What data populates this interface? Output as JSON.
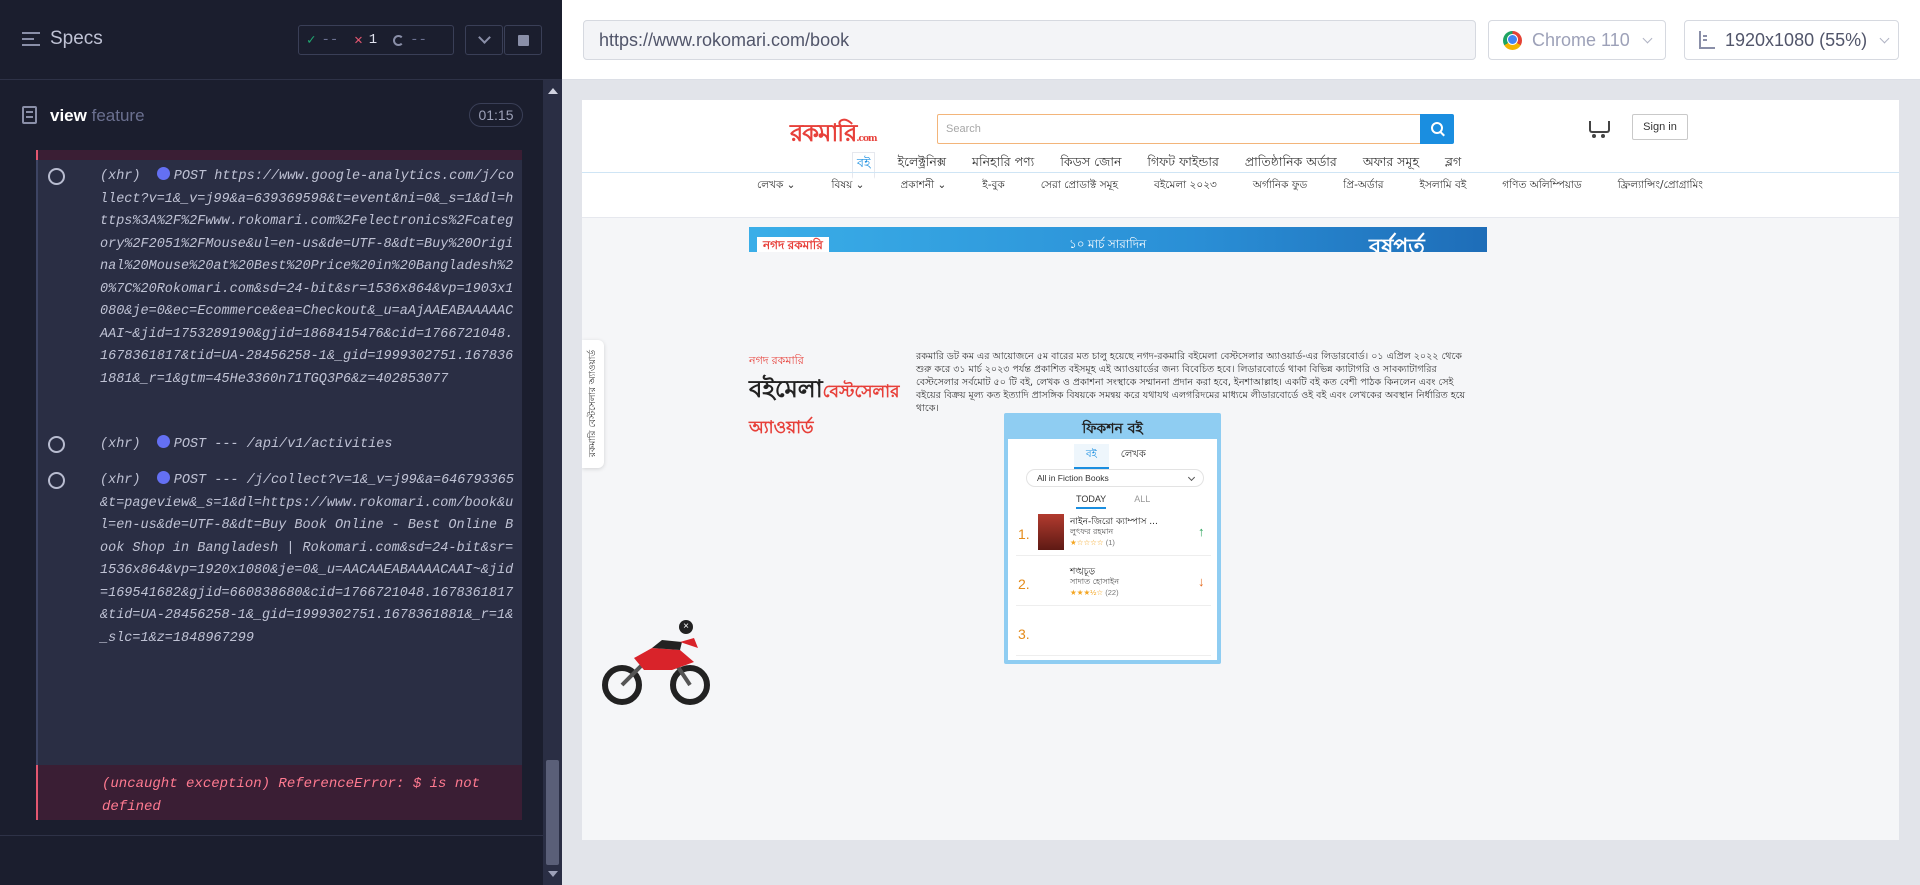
{
  "runner": {
    "specs_title": "Specs",
    "stats": {
      "passed": "--",
      "failed": "1",
      "pending": "--"
    },
    "spec": {
      "name_bold": "view",
      "name_light": "feature",
      "time": "01:15"
    },
    "commands": [
      {
        "type": "(xhr)",
        "method": "POST",
        "url": "https://www.google-analytics.com/j/collect?v=1&_v=j99&a=639369598&t=event&ni=0&_s=1&dl=https%3A%2F%2Fwww.rokomari.com%2Felectronics%2Fcategory%2F2051%2FMouse&ul=en-us&de=UTF-8&dt=Buy%20Original%20Mouse%20at%20Best%20Price%20in%20Bangladesh%20%7C%20Rokomari.com&sd=24-bit&sr=1536x864&vp=1903x1080&je=0&ec=Ecommerce&ea=Checkout&_u=aAjAAEABAAAAACAAI~&jid=1753289190&gjid=1868415476&cid=1766721048.1678361817&tid=UA-28456258-1&_gid=1999302751.1678361881&_r=1&gtm=45He3360n71TGQ3P6&z=402853077"
      },
      {
        "type": "(xhr)",
        "method": "POST",
        "url": "--- /api/v1/activities"
      },
      {
        "type": "(xhr)",
        "method": "POST",
        "url": "--- /j/collect?v=1&_v=j99&a=646793365&t=pageview&_s=1&dl=https://www.rokomari.com/book&ul=en-us&de=UTF-8&dt=Buy Book Online - Best Online Book Shop in Bangladesh | Rokomari.com&sd=24-bit&sr=1536x864&vp=1920x1080&je=0&_u=AACAAEABAAAACAAI~&jid=169541682&gjid=660838680&cid=1766721048.1678361817&tid=UA-28456258-1&_gid=1999302751.1678361881&_r=1&_slc=1&z=1848967299"
      }
    ],
    "error": "(uncaught exception)  ReferenceError: $ is not defined"
  },
  "aut": {
    "url": "https://www.rokomari.com/book",
    "browser": "Chrome 110",
    "viewport": "1920x1080  (55%)"
  },
  "site": {
    "logo_main": "রকমারি",
    "logo_suffix": ".com",
    "search_placeholder": "Search",
    "signin": "Sign in",
    "main_nav": [
      "বই",
      "ইলেক্ট্রনিক্স",
      "মনিহারি পণ্য",
      "কিডস জোন",
      "গিফট ফাইন্ডার",
      "প্রাতিষ্ঠানিক অর্ডার",
      "অফার সমূহ",
      "ব্লগ"
    ],
    "sub_nav": [
      "লেখক ⌄",
      "বিষয় ⌄",
      "প্রকাশনী ⌄",
      "ই-বুক",
      "সেরা প্রোডাক্ট সমূহ",
      "বইমেলা ২০২৩",
      "অর্গানিক ফুড",
      "প্রি-অর্ডার",
      "ইসলামি বই",
      "গণিত অলিম্পিয়াড",
      "ফ্রিল্যান্সিং/প্রোগ্রামিং"
    ],
    "banner": {
      "left": "নগদ  রকমারি",
      "mid": "১০ মার্চ সারাদিন",
      "right": "বর্ষপূর্ত"
    },
    "award": {
      "top": "নগদ  রকমারি",
      "main": "বইমেলা",
      "accent": "বেস্টসেলার অ্যাওয়ার্ড",
      "desc": "রকমারি ডট কম এর আয়োজনে ৫ম বারের মত চালু হয়েছে নগদ-রকমারি বইমেলা বেস্টসেলার অ্যাওয়ার্ড-এর লিডারবোর্ড। ০১ এপ্রিল ২০২২ থেকে শুরু করে ৩১ মার্চ ২০২৩ পর্যন্ত প্রকাশিত বইসমূহ এই অ্যাওয়ার্ডের জন্য বিবেচিত হবে। লিডারবোর্ডে থাকা বিভিন্ন ক্যাটাগরি ও সাবক্যাটাগরির বেস্টসেলার সর্বমোট ৫০ টি বই, লেখক ও প্রকাশনা সংস্থাকে সম্মাননা প্রদান করা হবে, ইনশাআল্লাহ। একটি বই কত বেশী পাঠক কিনলেন এবং সেই বইয়ের বিক্রয় মূল্য কত ইত্যাদি প্রাসঙ্গিক বিষয়কে সমন্বয় করে যথাযথ এলগরিদমের মাধ্যমে লীডারবোর্ডে ওই বই এবং লেখকের অবস্থান নির্ধারিত হয়ে থাকে।"
    },
    "side_tab": "রকমারি বেস্টসেলার অ্যাওয়ার্ড",
    "fiction": {
      "title": "ফিকশন বই",
      "tabs": [
        "বই",
        "লেখক"
      ],
      "dropdown": "All in Fiction Books",
      "subtabs": [
        "TODAY",
        "ALL"
      ],
      "rows": [
        {
          "rank": "1.",
          "title": "নাইন-জিরো ক্যাম্পাস ...",
          "author": "লুৎফর রহমান",
          "stars": "★☆☆☆☆",
          "count": "(1)",
          "trend": "↑",
          "trend_color": "#2aa45b"
        },
        {
          "rank": "2.",
          "title": "শঙ্খচূড়",
          "author": "সাদাত হোসাইন",
          "stars": "★★★½☆",
          "count": "(22)",
          "trend": "↓",
          "trend_color": "#e4671a"
        },
        {
          "rank": "3.",
          "title": "",
          "author": "",
          "stars": "",
          "count": "",
          "trend": "",
          "trend_color": "#2aa45b"
        }
      ]
    },
    "bike_close": "×"
  }
}
